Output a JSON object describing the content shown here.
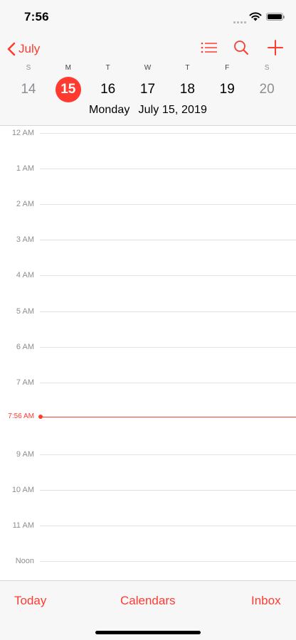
{
  "status_bar": {
    "time": "7:56"
  },
  "nav": {
    "back_label": "July"
  },
  "week": [
    {
      "letter": "S",
      "number": "14",
      "weekend": true,
      "selected": false
    },
    {
      "letter": "M",
      "number": "15",
      "weekend": false,
      "selected": true
    },
    {
      "letter": "T",
      "number": "16",
      "weekend": false,
      "selected": false
    },
    {
      "letter": "W",
      "number": "17",
      "weekend": false,
      "selected": false
    },
    {
      "letter": "T",
      "number": "18",
      "weekend": false,
      "selected": false
    },
    {
      "letter": "F",
      "number": "19",
      "weekend": false,
      "selected": false
    },
    {
      "letter": "S",
      "number": "20",
      "weekend": true,
      "selected": false
    }
  ],
  "selected_date": {
    "weekday": "Monday",
    "date": "July 15, 2019"
  },
  "timeline": {
    "hours": [
      "12 AM",
      "1 AM",
      "2 AM",
      "3 AM",
      "4 AM",
      "5 AM",
      "6 AM",
      "7 AM",
      "9 AM",
      "10 AM",
      "11 AM",
      "Noon"
    ],
    "current_time_label": "7:56 AM"
  },
  "tab_bar": {
    "today": "Today",
    "calendars": "Calendars",
    "inbox": "Inbox"
  },
  "colors": {
    "accent": "#ff3b30",
    "muted_text": "#8e8e93",
    "bar_background": "#f7f7f7"
  }
}
